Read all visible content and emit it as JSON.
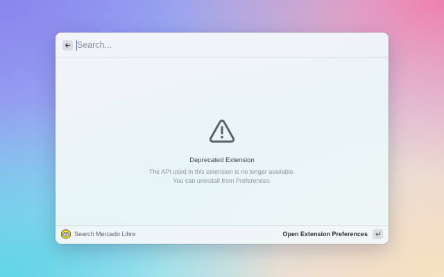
{
  "search": {
    "placeholder": "Search...",
    "value": "",
    "back_icon": "arrow-left-icon"
  },
  "empty_state": {
    "icon": "warning-triangle-icon",
    "title": "Deprecated Extension",
    "description_line1": "The API used in this extension is no longer available.",
    "description_line2": "You can uninstall from Preferences."
  },
  "action_bar": {
    "extension_icon": "mercado-libre-handshake-icon",
    "extension_title": "Search Mercado Libre",
    "primary_action_label": "Open Extension Preferences",
    "shortcut_icon": "return-key-icon"
  },
  "colors": {
    "accent_caret": "#3a7bf0",
    "mercado_libre_yellow": "#ffe600"
  }
}
